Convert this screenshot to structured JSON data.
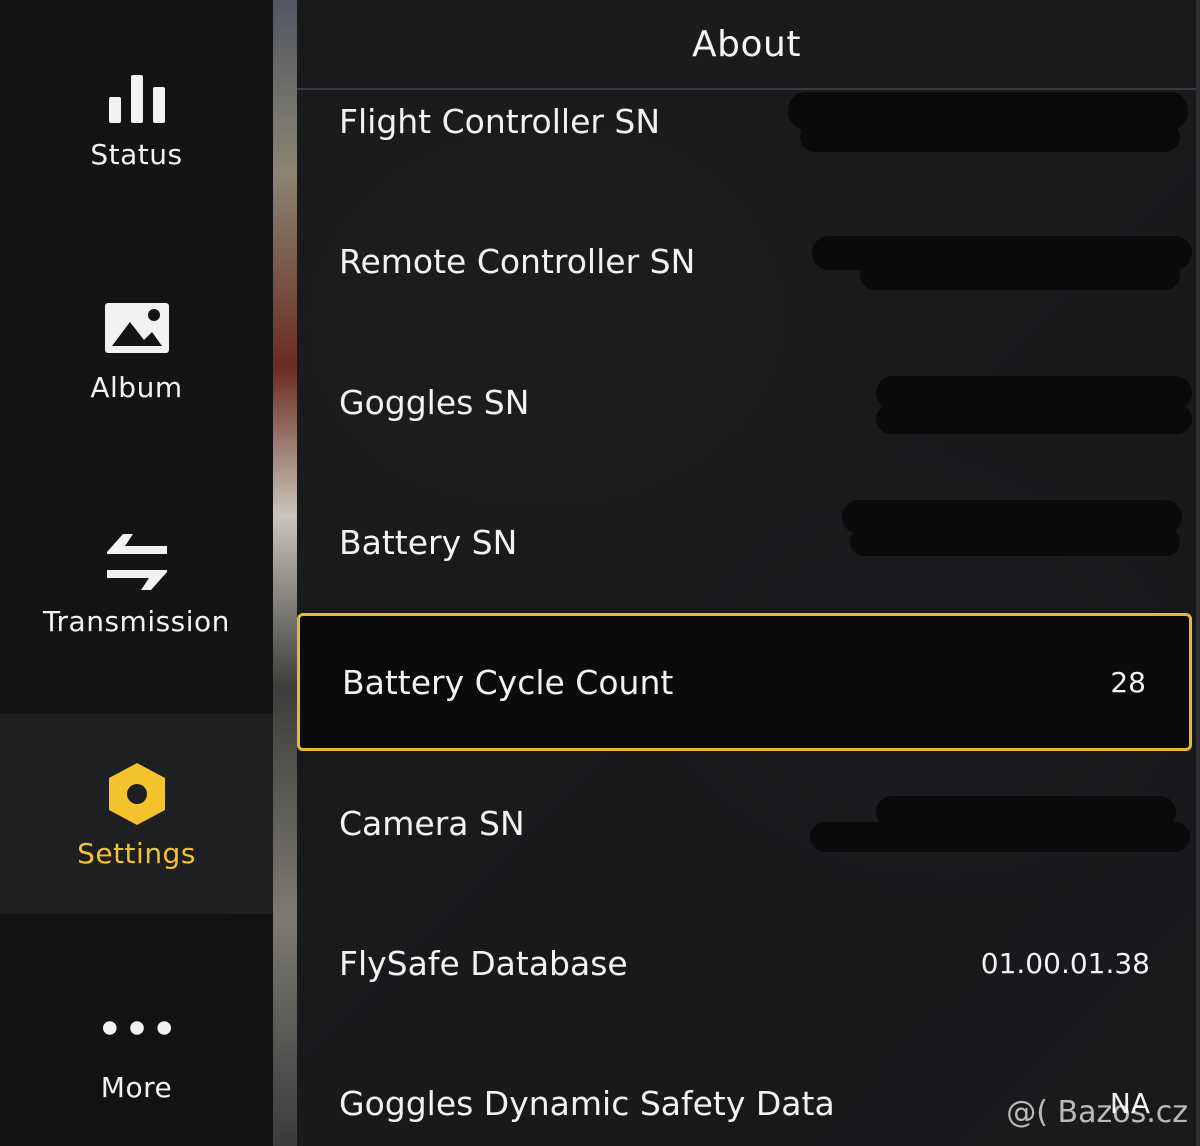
{
  "sidebar": {
    "items": [
      {
        "label": "Status",
        "icon": "bar-chart-icon",
        "active": false
      },
      {
        "label": "Album",
        "icon": "image-icon",
        "active": false
      },
      {
        "label": "Transmission",
        "icon": "swap-arrows-icon",
        "active": false
      },
      {
        "label": "Settings",
        "icon": "hexagon-gear-icon",
        "active": true
      },
      {
        "label": "More",
        "icon": "more-dots-icon",
        "active": false
      }
    ]
  },
  "panel": {
    "title": "About",
    "rows": [
      {
        "label": "Flight Controller SN",
        "value": "",
        "redacted": true
      },
      {
        "label": "Remote Controller SN",
        "value": "",
        "redacted": true
      },
      {
        "label": "Goggles SN",
        "value": "",
        "redacted": true
      },
      {
        "label": "Battery SN",
        "value": "",
        "redacted": true
      },
      {
        "label": "Battery Cycle Count",
        "value": "28",
        "selected": true
      },
      {
        "label": "Camera SN",
        "value": "",
        "redacted": true
      },
      {
        "label": "FlySafe Database",
        "value": "01.00.01.38"
      },
      {
        "label": "Goggles Dynamic Safety Data",
        "value": "NA"
      }
    ]
  },
  "watermark": "@( Bazos.cz",
  "colors": {
    "accent": "#f3c22c",
    "selected_border": "#e9b930",
    "panel_bg": "#18191b",
    "sidebar_bg": "#121213",
    "text": "#f2f2f2"
  }
}
